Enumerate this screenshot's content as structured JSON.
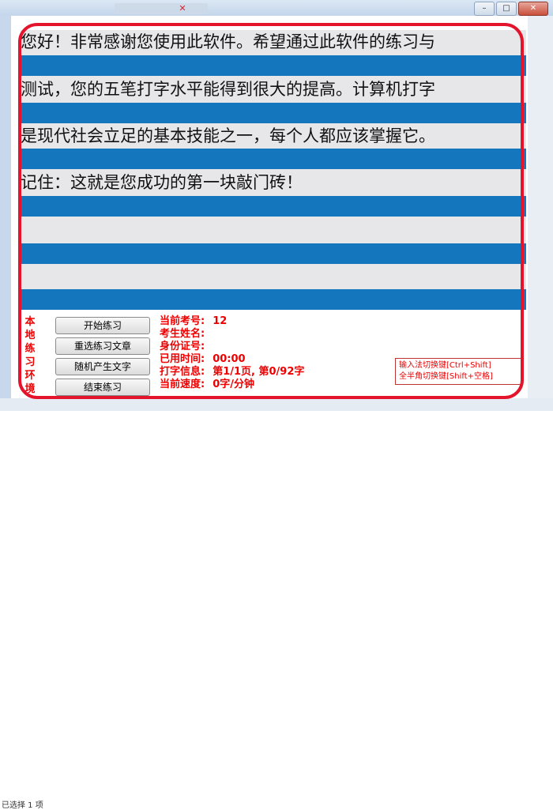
{
  "window": {
    "tab_title": "",
    "tab_icon": "app-icon",
    "controls": {
      "minimize": "–",
      "maximize": "□",
      "close": "✕"
    }
  },
  "practice_text": {
    "lines": [
      "您好！非常感谢您使用此软件。希望通过此软件的练习与",
      "测试，您的五笔打字水平能得到很大的提高。计算机打字",
      "是现代社会立足的基本技能之一，每个人都应该掌握它。",
      "记住：这就是您成功的第一块敲门砖！"
    ]
  },
  "panel": {
    "mode_label": [
      "本",
      "地",
      "练",
      "习",
      "环",
      "境"
    ],
    "buttons": {
      "start": "开始练习",
      "reselect": "重选练习文章",
      "random": "随机产生文字",
      "end": "结束练习"
    },
    "info": {
      "exam_no_label": "当前考号:",
      "exam_no_value": "12",
      "name_label": "考生姓名:",
      "id_label": "身份证号:",
      "elapsed_label": "已用时间:",
      "elapsed_value": "00:00",
      "typing_label": "打字信息:",
      "typing_value": "第1/1页, 第0/92字",
      "speed_label": "当前速度:",
      "speed_value": "0字/分钟"
    },
    "hints": {
      "ime_switch": "输入法切换键[Ctrl+Shift]",
      "width_switch": "全半角切换键[Shift+空格]"
    }
  },
  "status_bar": {
    "text": "已选择 1 项"
  },
  "colors": {
    "stripe_blue": "#1477bd",
    "stripe_grey": "#e7e7e9",
    "highlight_red": "#e3142b"
  }
}
